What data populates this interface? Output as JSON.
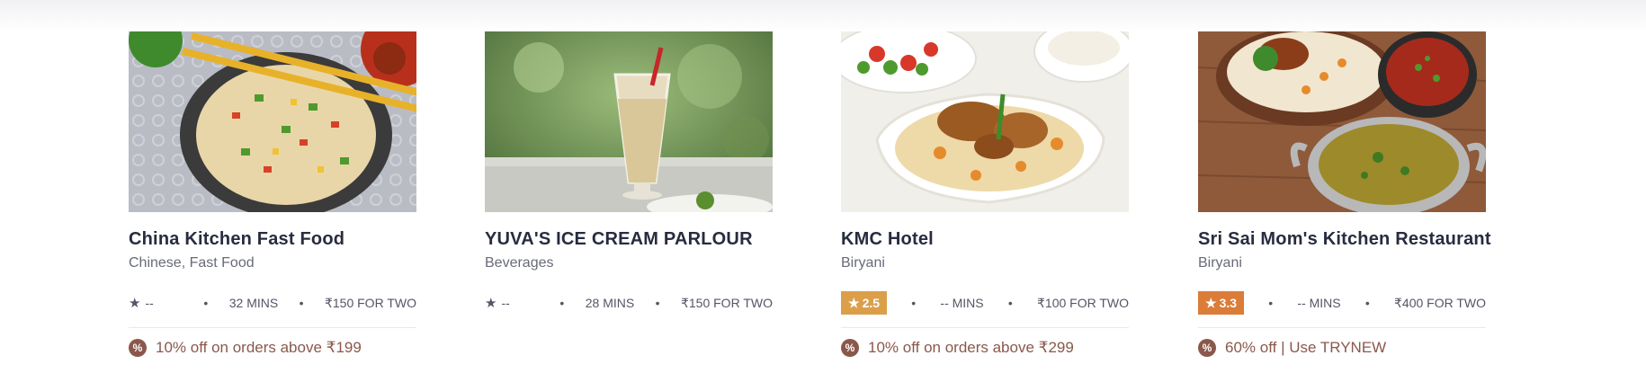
{
  "restaurants": [
    {
      "name": "China Kitchen Fast Food",
      "cuisine": "Chinese, Fast Food",
      "rating": "--",
      "rating_color": "",
      "eta": "32 MINS",
      "cost": "₹150 FOR TWO",
      "offer": "10% off on orders above ₹199",
      "image_icon": "fried-rice-bowl-image"
    },
    {
      "name": "YUVA'S ICE CREAM PARLOUR",
      "cuisine": "Beverages",
      "rating": "--",
      "rating_color": "",
      "eta": "28 MINS",
      "cost": "₹150 FOR TWO",
      "offer": "",
      "image_icon": "milkshake-glass-image"
    },
    {
      "name": "KMC Hotel",
      "cuisine": "Biryani",
      "rating": "2.5",
      "rating_color": "#db9f4a",
      "eta": "-- MINS",
      "cost": "₹100 FOR TWO",
      "offer": "10% off on orders above ₹299",
      "image_icon": "chicken-biryani-plate-image"
    },
    {
      "name": "Sri Sai Mom's Kitchen Restaurant",
      "cuisine": "Biryani",
      "rating": "3.3",
      "rating_color": "#db7c38",
      "eta": "-- MINS",
      "cost": "₹400 FOR TWO",
      "offer": "60% off | Use TRYNEW",
      "image_icon": "biryani-curry-table-image"
    }
  ],
  "symbols": {
    "star": "★",
    "dot": "•",
    "offer_icon": "%"
  },
  "colors": {
    "title": "#282c3f",
    "subtitle": "#686b78",
    "offer": "#8a584b"
  }
}
